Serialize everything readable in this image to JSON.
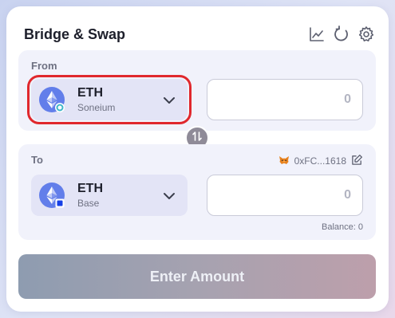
{
  "header": {
    "title": "Bridge & Swap",
    "icons": [
      "chart-icon",
      "refresh-icon",
      "settings-icon"
    ]
  },
  "from": {
    "label": "From",
    "token": "ETH",
    "chain": "Soneium",
    "amount_placeholder": "0"
  },
  "to": {
    "label": "To",
    "token": "ETH",
    "chain": "Base",
    "amount_placeholder": "0",
    "wallet_address": "0xFC...1618",
    "balance": "Balance: 0"
  },
  "action": {
    "label": "Enter Amount"
  },
  "colors": {
    "highlight": "#e0282d",
    "eth": "#627eea",
    "panel": "#f1f2fb",
    "select": "#e3e4f6"
  }
}
